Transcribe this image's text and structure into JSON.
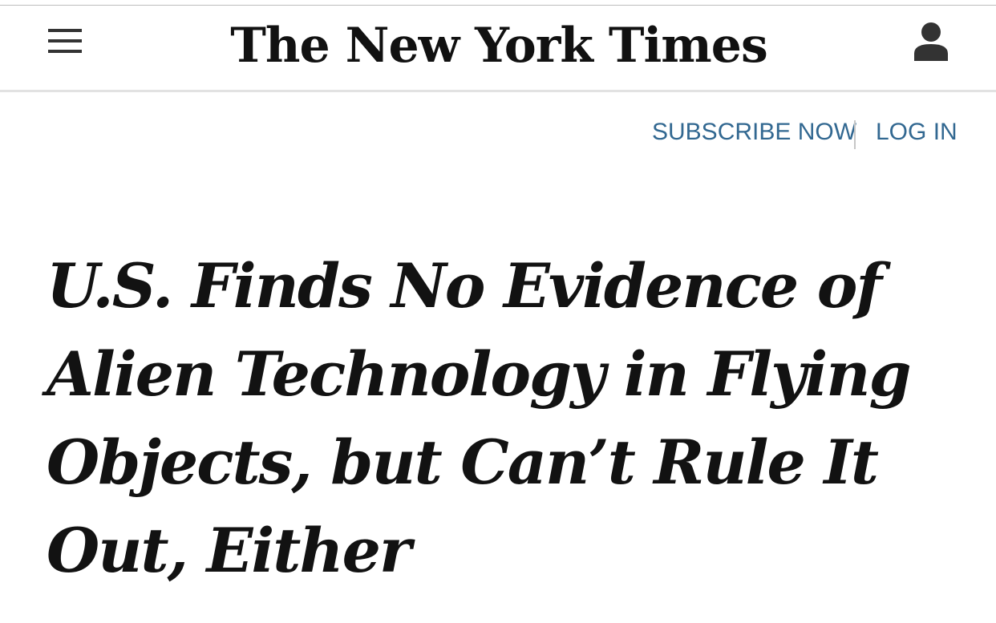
{
  "masthead": {
    "logo_text": "The New York Times",
    "menu_icon": "hamburger-menu-icon",
    "account_icon": "user-account-icon"
  },
  "auth": {
    "subscribe_label": "SUBSCRIBE NOW",
    "login_label": "LOG IN",
    "link_color": "#326891"
  },
  "article": {
    "headline": "U.S. Finds No Evidence of Alien Technology in Flying Objects, but Can’t Rule It Out, Either"
  }
}
